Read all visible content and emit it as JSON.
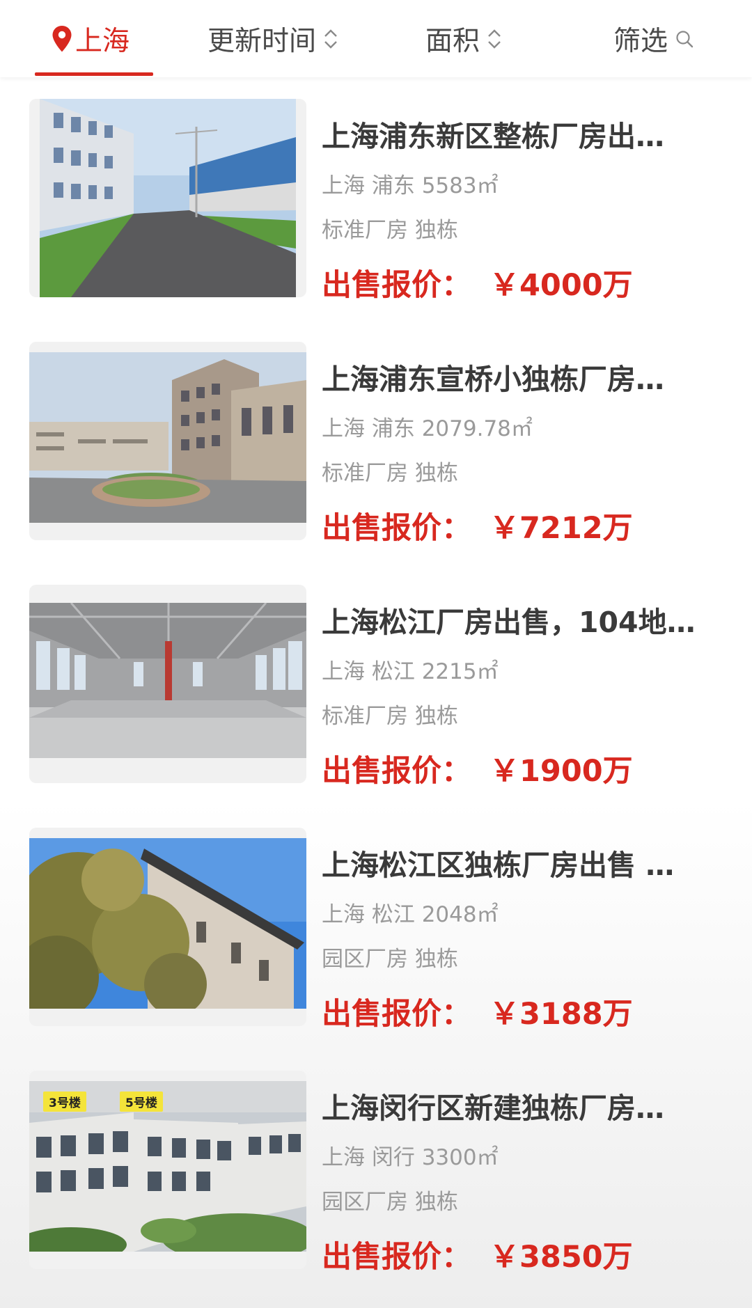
{
  "header": {
    "city_label": "上海",
    "sort_time_label": "更新时间",
    "sort_area_label": "面积",
    "filter_label": "筛选"
  },
  "colors": {
    "accent": "#d8281f",
    "title_text": "#3a3a3a",
    "meta_text": "#9a9a9a"
  },
  "listings": [
    {
      "title": "上海浦东新区整栋厂房出…",
      "location": "上海 浦东 5583㎡",
      "tags": "标准厂房 独栋",
      "price_label": "出售报价：",
      "price": "￥4000万"
    },
    {
      "title": "上海浦东宣桥小独栋厂房…",
      "location": "上海 浦东 2079.78㎡",
      "tags": "标准厂房 独栋",
      "price_label": "出售报价：",
      "price": "￥7212万"
    },
    {
      "title": "上海松江厂房出售，104地…",
      "location": "上海 松江 2215㎡",
      "tags": "标准厂房 独栋",
      "price_label": "出售报价：",
      "price": "￥1900万"
    },
    {
      "title": "上海松江区独栋厂房出售 …",
      "location": "上海 松江 2048㎡",
      "tags": "园区厂房 独栋",
      "price_label": "出售报价：",
      "price": "￥3188万"
    },
    {
      "title": "上海闵行区新建独栋厂房…",
      "location": "上海 闵行 3300㎡",
      "tags": "园区厂房 独栋",
      "price_label": "出售报价：",
      "price": "￥3850万",
      "photo_labels": [
        "3号楼",
        "5号楼"
      ]
    }
  ]
}
